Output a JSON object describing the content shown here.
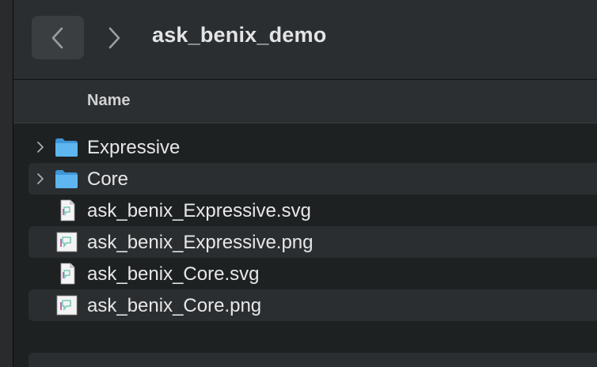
{
  "toolbar": {
    "back_icon": "chevron-left-icon",
    "forward_icon": "chevron-right-icon",
    "title": "ask_benix_demo"
  },
  "header": {
    "name_column": "Name"
  },
  "files": [
    {
      "name": "Expressive",
      "kind": "folder",
      "icon": "folder-icon",
      "expandable": true
    },
    {
      "name": "Core",
      "kind": "folder",
      "icon": "folder-icon",
      "expandable": true
    },
    {
      "name": "ask_benix_Expressive.svg",
      "kind": "svg",
      "icon": "svg-file-icon",
      "expandable": false
    },
    {
      "name": "ask_benix_Expressive.png",
      "kind": "png",
      "icon": "png-file-icon",
      "expandable": false
    },
    {
      "name": "ask_benix_Core.svg",
      "kind": "svg",
      "icon": "svg-file-icon",
      "expandable": false
    },
    {
      "name": "ask_benix_Core.png",
      "kind": "png",
      "icon": "png-file-icon",
      "expandable": false
    }
  ],
  "colors": {
    "folder": "#5eb6f0",
    "background": "#1e2122",
    "toolbar": "#2b2e31",
    "text": "#e6e7e8"
  }
}
